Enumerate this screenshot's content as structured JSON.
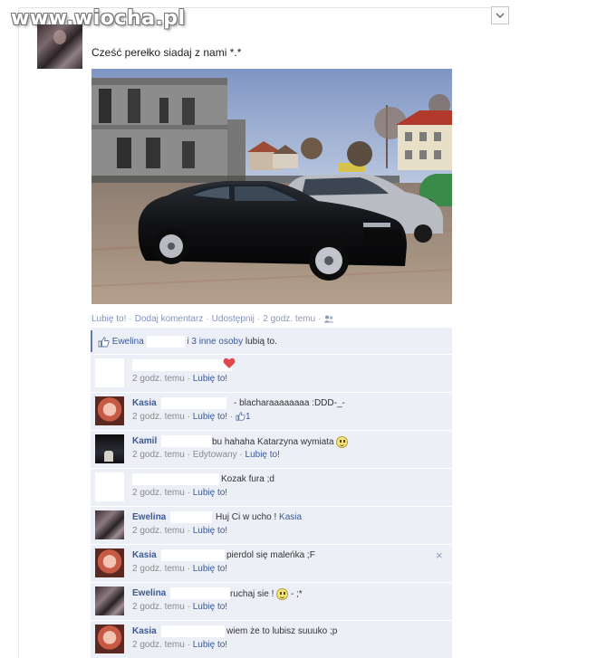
{
  "watermark": "www.wiocha.pl",
  "post": {
    "text": "Cześć perełko siadaj z nami *.*",
    "actions": {
      "like": "Lubię to!",
      "comment": "Dodaj komentarz",
      "share": "Udostępnij",
      "time": "2 godz. temu",
      "audience_icon": "friends-icon"
    }
  },
  "likes": {
    "name": "Ewelina",
    "others": "i 3 inne osoby",
    "suffix": "lubią to."
  },
  "comments": [
    {
      "name": "",
      "text": "",
      "time": "2 godz. temu",
      "like": "Lubię to!",
      "icon": "heart-icon"
    },
    {
      "name": "Kasia",
      "text": "- blacharaaaaaaaa :DDD-_-",
      "time": "2 godz. temu",
      "like": "Lubię to!",
      "like_count": "1"
    },
    {
      "name": "Kamil",
      "text": "bu hahaha Katarzyna wymiata",
      "time": "2 godz. temu",
      "edited": "Edytowany",
      "like": "Lubię to!"
    },
    {
      "name": "",
      "text": "Kozak fura ;d",
      "time": "2 godz. temu",
      "like": "Lubię to!"
    },
    {
      "name": "Ewelina",
      "text": "Huj Ci w ucho !",
      "mention": "Kasia",
      "time": "2 godz. temu",
      "like": "Lubię to!"
    },
    {
      "name": "Kasia",
      "text": "pierdol się maleńka ;F",
      "time": "2 godz. temu",
      "like": "Lubię to!",
      "close": "×"
    },
    {
      "name": "Ewelina",
      "text": "ruchaj sie !",
      "text_after": "- ;*",
      "time": "2 godz. temu",
      "like": "Lubię to!"
    },
    {
      "name": "Kasia",
      "text": "wiem że to lubisz suuuko ;p",
      "time": "2 godz. temu",
      "like": "Lubię to!"
    }
  ],
  "colors": {
    "link": "#3b5998",
    "comments_bg": "#eceff5",
    "heart": "#e0474c"
  }
}
